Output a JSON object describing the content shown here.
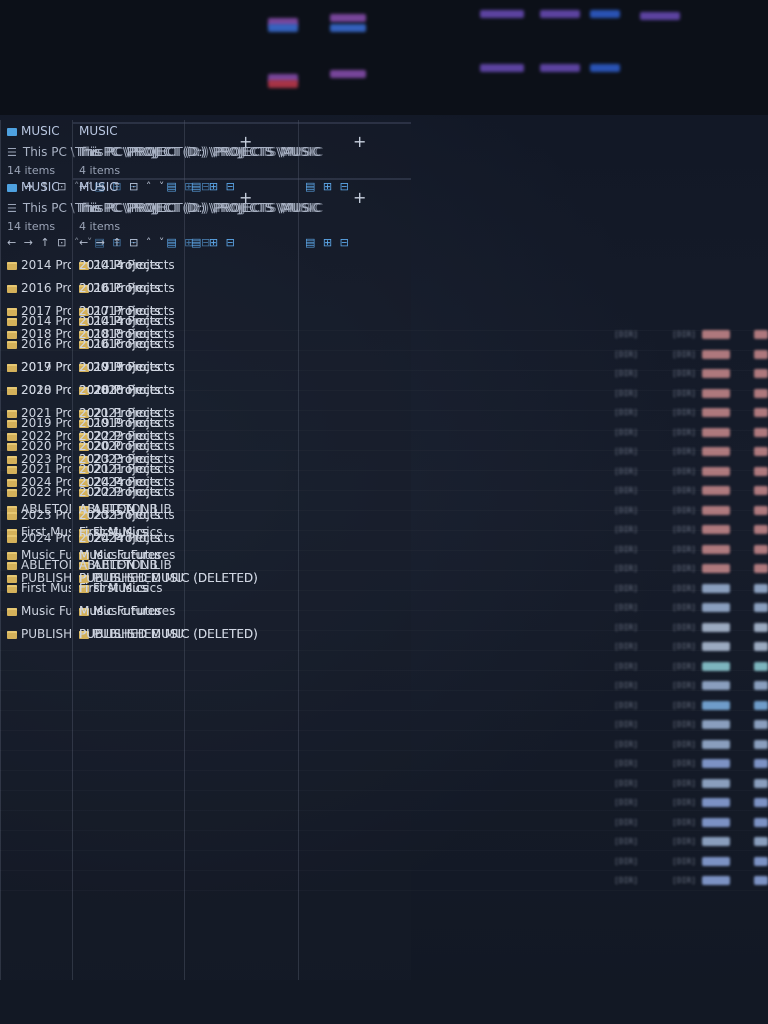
{
  "window": {
    "title": "MUSIC",
    "path_short": "This PC \\",
    "path_full": "This PC \\PROJECT (D:) \\PROJECTS \\MUSIC",
    "item_count_all": "14 items",
    "item_count_visible": "4 items"
  },
  "toolbar": {
    "nav": "← → ↑ ⊡ ˄ ˅",
    "view": "▤ ⊞ ⊟"
  },
  "items": [
    "2014 Projects",
    "2016 Projects",
    "2017 Projects",
    "2018 Projects",
    "2019 Projects",
    "2020 Projects",
    "2021 Projects",
    "2022 Projects",
    "2023 Projects",
    "2024 Projects",
    "ABLETON LIB",
    "First Musics",
    "Music Futures",
    "PUBLISHED MUSIC (DELETED)"
  ],
  "detail_tag": "[DIR]",
  "colors": {
    "background": "#141a26",
    "folder": "#d4b15a",
    "accent": "#4ea1e0",
    "text": "#cfd5e1"
  }
}
